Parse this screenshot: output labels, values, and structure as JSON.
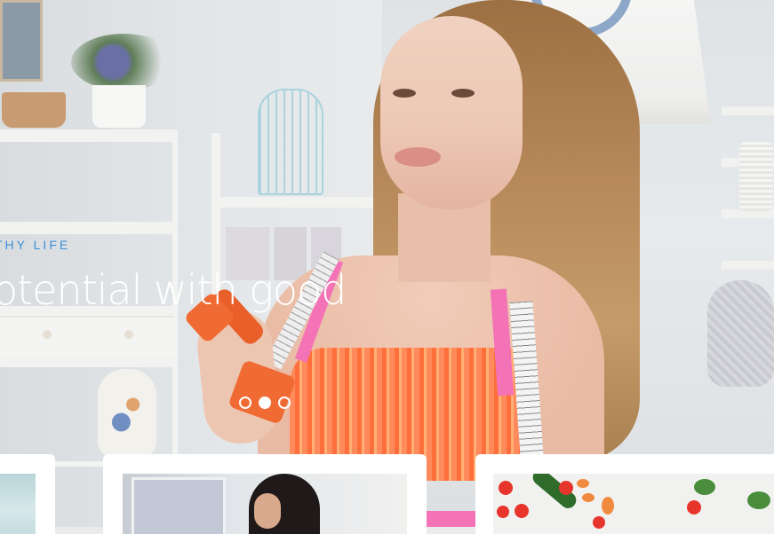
{
  "hero": {
    "eyebrow": "THY LIFE",
    "headline": "otential with good"
  },
  "slider": {
    "dots": [
      "slide-1",
      "slide-2",
      "slide-3"
    ],
    "active_index": 1
  },
  "cards": [
    {
      "label": "post-card-1"
    },
    {
      "label": "post-card-2"
    },
    {
      "label": "post-card-3"
    }
  ],
  "colors": {
    "accent": "#3b8fd9",
    "headline": "#ffffff",
    "card_bg": "#ffffff"
  }
}
